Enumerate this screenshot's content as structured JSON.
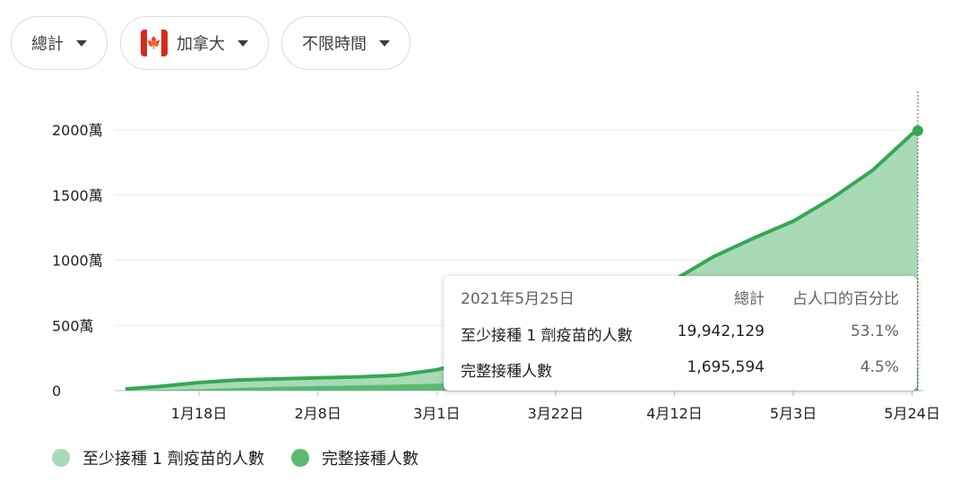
{
  "filters": [
    {
      "label": "總計"
    },
    {
      "label": "加拿大",
      "flag": "canada-flag-icon"
    },
    {
      "label": "不限時間"
    }
  ],
  "colors": {
    "first_dose": "#a8dab5",
    "first_dose_line": "#34a853",
    "full": "#5bb974",
    "grid": "#e8eaed"
  },
  "tooltip": {
    "date": "2021年5月25日",
    "col_total": "總計",
    "col_pct": "占人口的百分比",
    "rows": [
      {
        "label": "至少接種 1 劑疫苗的人數",
        "total": "19,942,129",
        "pct": "53.1%"
      },
      {
        "label": "完整接種人數",
        "total": "1,695,594",
        "pct": "4.5%"
      }
    ]
  },
  "legend": [
    {
      "label": "至少接種 1 劑疫苗的人數",
      "color": "#a8dab5"
    },
    {
      "label": "完整接種人數",
      "color": "#5bb974"
    }
  ],
  "chart_data": {
    "type": "area",
    "y_ticks": [
      "0",
      "500萬",
      "1000萬",
      "1500萬",
      "2000萬"
    ],
    "y_tick_values": [
      0,
      5000000,
      10000000,
      15000000,
      20000000
    ],
    "ylim": [
      0,
      20000000
    ],
    "x_ticks": [
      "1月18日",
      "2月8日",
      "3月1日",
      "3月22日",
      "4月12日",
      "5月3日",
      "5月24日"
    ],
    "x_tick_days": [
      17,
      38,
      59,
      80,
      101,
      122,
      143
    ],
    "xlim_days": [
      4,
      144
    ],
    "grid": true,
    "legend_position": "bottom-left",
    "series": [
      {
        "name": "至少接種 1 劑疫苗的人數",
        "points": [
          [
            4,
            120000
          ],
          [
            10,
            320000
          ],
          [
            17,
            620000
          ],
          [
            24,
            820000
          ],
          [
            31,
            900000
          ],
          [
            38,
            980000
          ],
          [
            45,
            1050000
          ],
          [
            52,
            1180000
          ],
          [
            59,
            1600000
          ],
          [
            66,
            2300000
          ],
          [
            73,
            3200000
          ],
          [
            80,
            4300000
          ],
          [
            87,
            5400000
          ],
          [
            94,
            6700000
          ],
          [
            101,
            8500000
          ],
          [
            108,
            10300000
          ],
          [
            115,
            11700000
          ],
          [
            122,
            13000000
          ],
          [
            129,
            14800000
          ],
          [
            136,
            16900000
          ],
          [
            143,
            19700000
          ],
          [
            144,
            19942129
          ]
        ]
      },
      {
        "name": "完整接種人數",
        "points": [
          [
            4,
            0
          ],
          [
            17,
            100000
          ],
          [
            31,
            300000
          ],
          [
            45,
            400000
          ],
          [
            59,
            520000
          ],
          [
            73,
            650000
          ],
          [
            87,
            850000
          ],
          [
            101,
            1000000
          ],
          [
            115,
            1200000
          ],
          [
            129,
            1400000
          ],
          [
            144,
            1695594
          ]
        ]
      }
    ]
  }
}
